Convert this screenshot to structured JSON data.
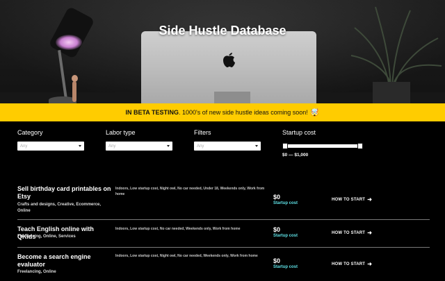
{
  "hero": {
    "title": "Side Hustle Database"
  },
  "beta": {
    "label": "IN BETA TESTING",
    "message": ". 1000's of new side hustle ideas coming soon!",
    "emoji": "🤯"
  },
  "filters": [
    {
      "label": "Category",
      "value": "Any"
    },
    {
      "label": "Labor type",
      "value": "Any"
    },
    {
      "label": "Filters",
      "value": "Any"
    }
  ],
  "startup_cost": {
    "label": "Startup cost",
    "range_text": "$0 — $1,000",
    "min_fraction": 0,
    "max_fraction": 1
  },
  "hustles": [
    {
      "title": "Sell birthday card printables on Etsy",
      "categories": "Crafts and designs, Creative, Ecommerce, Online",
      "tags": "Indoors, Low startup cost, Night owl, No car needed, Under 18, Weekends only, Work from home",
      "cost": "$0",
      "cost_label": "Startup cost",
      "cta": "HOW TO START"
    },
    {
      "title": "Teach English online with QKids",
      "categories": "Freelancing, Online, Services",
      "tags": "Indoors, Low startup cost, No car needed, Weekends only, Work from home",
      "cost": "$0",
      "cost_label": "Startup cost",
      "cta": "HOW TO START"
    },
    {
      "title": "Become a search engine evaluator",
      "categories": "Freelancing, Online",
      "tags": "Indoors, Low startup cost, Night owl, No car needed, Weekends only, Work from home",
      "cost": "$0",
      "cost_label": "Startup cost",
      "cta": "HOW TO START"
    }
  ],
  "colors": {
    "beta_bar": "#ffcc00",
    "cost_label": "#5fe3e8",
    "background": "#000000"
  }
}
